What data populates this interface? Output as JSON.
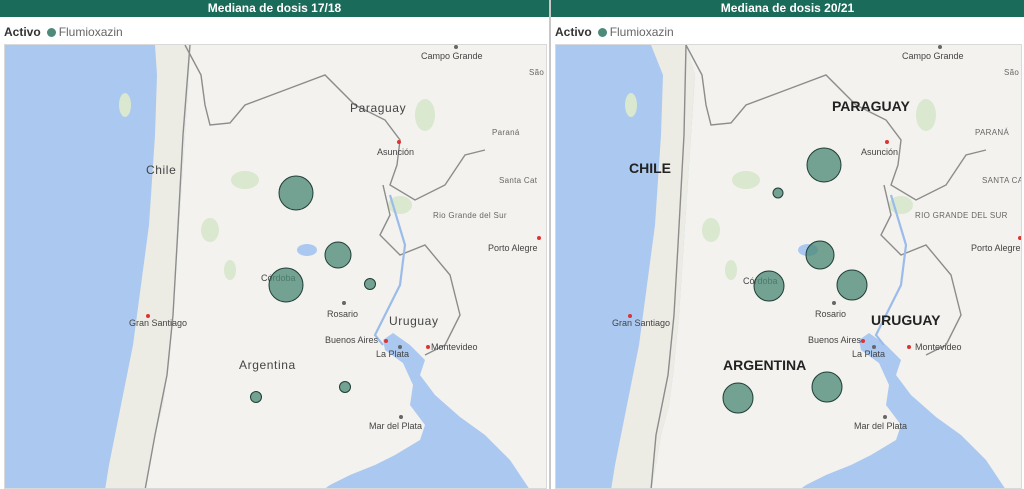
{
  "accent_color": "#1b6b5b",
  "bubble_color": "#4e8a79",
  "legend": {
    "title": "Activo",
    "item": "Flumioxazin"
  },
  "panels": [
    {
      "title": "Mediana de dosis 17/18",
      "labels": {
        "campo_grande": "Campo Grande",
        "sao": "São",
        "paraguay": "Paraguay",
        "parana": "Paraná",
        "asuncion": "Asunción",
        "santa_cat": "Santa Cat",
        "chile": "Chile",
        "rio_grande": "Rio Grande del Sur",
        "porto_alegre": "Porto Alegre",
        "cordoba": "Córdoba",
        "gran_santiago": "Gran Santiago",
        "rosario": "Rosario",
        "uruguay": "Uruguay",
        "buenos_aires": "Buenos Aires",
        "la_plata": "La Plata",
        "montevideo": "Montevideo",
        "argentina": "Argentina",
        "mar_del_plata": "Mar del Plata"
      }
    },
    {
      "title": "Mediana de dosis 20/21",
      "labels": {
        "campo_grande": "Campo Grande",
        "sao": "São",
        "paraguay": "PARAGUAY",
        "parana": "PARANÁ",
        "asuncion": "Asunción",
        "santa_cat": "SANTA CAT",
        "chile": "CHILE",
        "rio_grande": "RIO GRANDE DEL SUR",
        "porto_alegre": "Porto Alegre",
        "cordoba": "Córdoba",
        "gran_santiago": "Gran Santiago",
        "rosario": "Rosario",
        "uruguay": "URUGUAY",
        "buenos_aires": "Buenos Aires",
        "la_plata": "La Plata",
        "montevideo": "Montevideo",
        "argentina": "ARGENTINA",
        "mar_del_plata": "Mar del Plata"
      }
    }
  ]
}
